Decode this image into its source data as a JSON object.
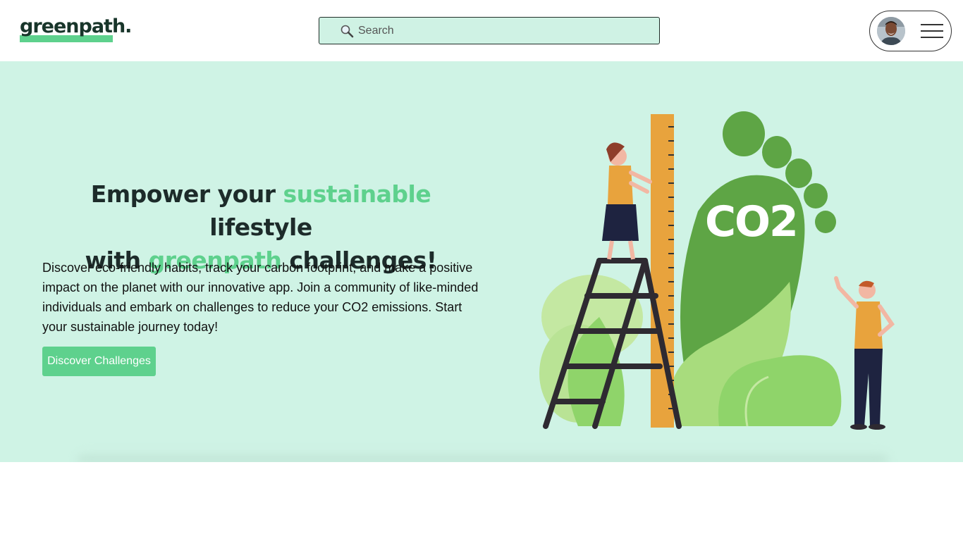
{
  "header": {
    "logo": "greenpath.",
    "search": {
      "placeholder": "Search",
      "icon": "magnifier-icon"
    },
    "user_menu": {
      "avatar": "user-avatar",
      "menu_icon": "hamburger-icon"
    }
  },
  "hero": {
    "headline": {
      "line1_pre": "Empower your ",
      "line1_accent": "sustainable",
      "line1_post": " lifestyle",
      "line2_pre": "with ",
      "line2_accent": "greenpath",
      "line2_post": " challenges!"
    },
    "description": "Discover eco-friendly habits, track your carbon footprint, and make a positive impact on the planet with our innovative app. Join a community of like-minded individuals and embark on challenges to reduce your CO2 emissions. Start your sustainable journey today!",
    "cta_label": "Discover Challenges",
    "illustration": {
      "footprint_label": "CO2"
    }
  },
  "colors": {
    "accent": "#5ed18d",
    "hero_bg": "#cff3e5",
    "search_bg": "#cff2e4",
    "text_dark": "#1d2b2a"
  }
}
